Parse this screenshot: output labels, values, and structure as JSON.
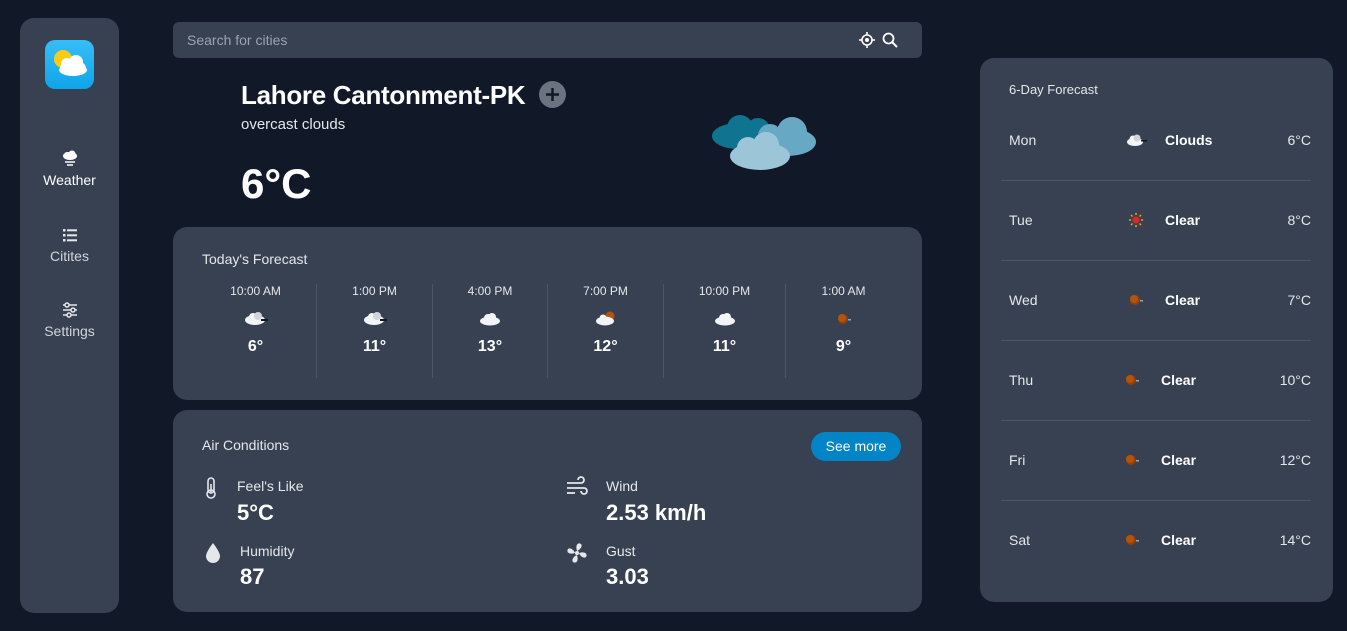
{
  "sidebar": {
    "items": [
      {
        "label": "Weather",
        "icon": "cloud-rain-icon"
      },
      {
        "label": "Citites",
        "icon": "list-icon"
      },
      {
        "label": "Settings",
        "icon": "sliders-icon"
      }
    ]
  },
  "search": {
    "placeholder": "Search for cities"
  },
  "current": {
    "city": "Lahore Cantonment-PK",
    "description": "overcast clouds",
    "temperature": "6°C"
  },
  "today": {
    "title": "Today's Forecast",
    "hours": [
      {
        "time": "10:00 AM",
        "temp": "6°",
        "icon": "cloudy-icon"
      },
      {
        "time": "1:00 PM",
        "temp": "11°",
        "icon": "cloudy-icon"
      },
      {
        "time": "4:00 PM",
        "temp": "13°",
        "icon": "cloud-icon"
      },
      {
        "time": "7:00 PM",
        "temp": "12°",
        "icon": "partly-cloudy-night-icon"
      },
      {
        "time": "10:00 PM",
        "temp": "11°",
        "icon": "cloud-icon"
      },
      {
        "time": "1:00 AM",
        "temp": "9°",
        "icon": "moon-icon"
      }
    ]
  },
  "air": {
    "title": "Air Conditions",
    "see_more": "See more",
    "feels_like": {
      "label": "Feel's Like",
      "value": "5°C"
    },
    "wind": {
      "label": "Wind",
      "value": "2.53 km/h"
    },
    "humidity": {
      "label": "Humidity",
      "value": "87"
    },
    "gust": {
      "label": "Gust",
      "value": "3.03"
    }
  },
  "week": {
    "title": "6-Day Forecast",
    "days": [
      {
        "day": "Mon",
        "cond": "Clouds",
        "temp": "6°C",
        "icon": "cloud-icon"
      },
      {
        "day": "Tue",
        "cond": "Clear",
        "temp": "8°C",
        "icon": "sun-icon"
      },
      {
        "day": "Wed",
        "cond": "Clear",
        "temp": "7°C",
        "icon": "moon-icon"
      },
      {
        "day": "Thu",
        "cond": "Clear",
        "temp": "10°C",
        "icon": "moon-icon"
      },
      {
        "day": "Fri",
        "cond": "Clear",
        "temp": "12°C",
        "icon": "moon-icon"
      },
      {
        "day": "Sat",
        "cond": "Clear",
        "temp": "14°C",
        "icon": "moon-icon"
      }
    ]
  },
  "colors": {
    "background": "#111827",
    "panel": "#374151",
    "accent": "#0284c7"
  }
}
